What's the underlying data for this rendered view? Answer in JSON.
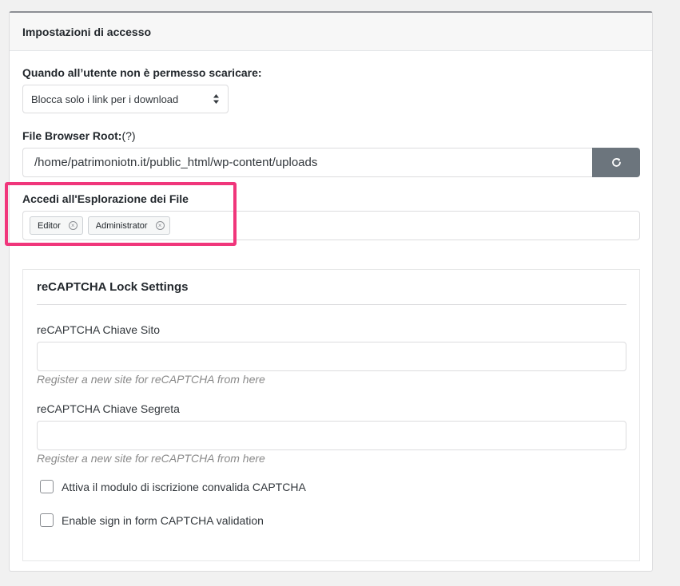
{
  "panel": {
    "title": "Impostazioni di accesso"
  },
  "download_block": {
    "label": "Quando all’utente non è permesso scaricare:",
    "selected": "Blocca solo i link per i download"
  },
  "file_browser_root": {
    "label": "File Browser Root:",
    "help_marker": "(?)",
    "value": "/home/patrimoniotn.it/public_html/wp-content/uploads",
    "refresh_icon": "refresh-icon"
  },
  "file_explorer_access": {
    "label": "Accedi all'Esplorazione dei File",
    "tags": [
      {
        "label": "Editor"
      },
      {
        "label": "Administrator"
      }
    ],
    "highlight_color": "#f0367b"
  },
  "recaptcha": {
    "title": "reCAPTCHA Lock Settings",
    "site_key_label": "reCAPTCHA Chiave Sito",
    "site_key_value": "",
    "site_key_help": "Register a new site for reCAPTCHA from here",
    "secret_key_label": "reCAPTCHA Chiave Segreta",
    "secret_key_value": "",
    "secret_key_help": "Register a new site for reCAPTCHA from here",
    "checkboxes": [
      {
        "label": "Attiva il modulo di iscrizione convalida CAPTCHA",
        "checked": false
      },
      {
        "label": "Enable sign in form CAPTCHA validation",
        "checked": false
      }
    ]
  },
  "colors": {
    "button_gray": "#6c757d",
    "highlight": "#f0367b"
  }
}
